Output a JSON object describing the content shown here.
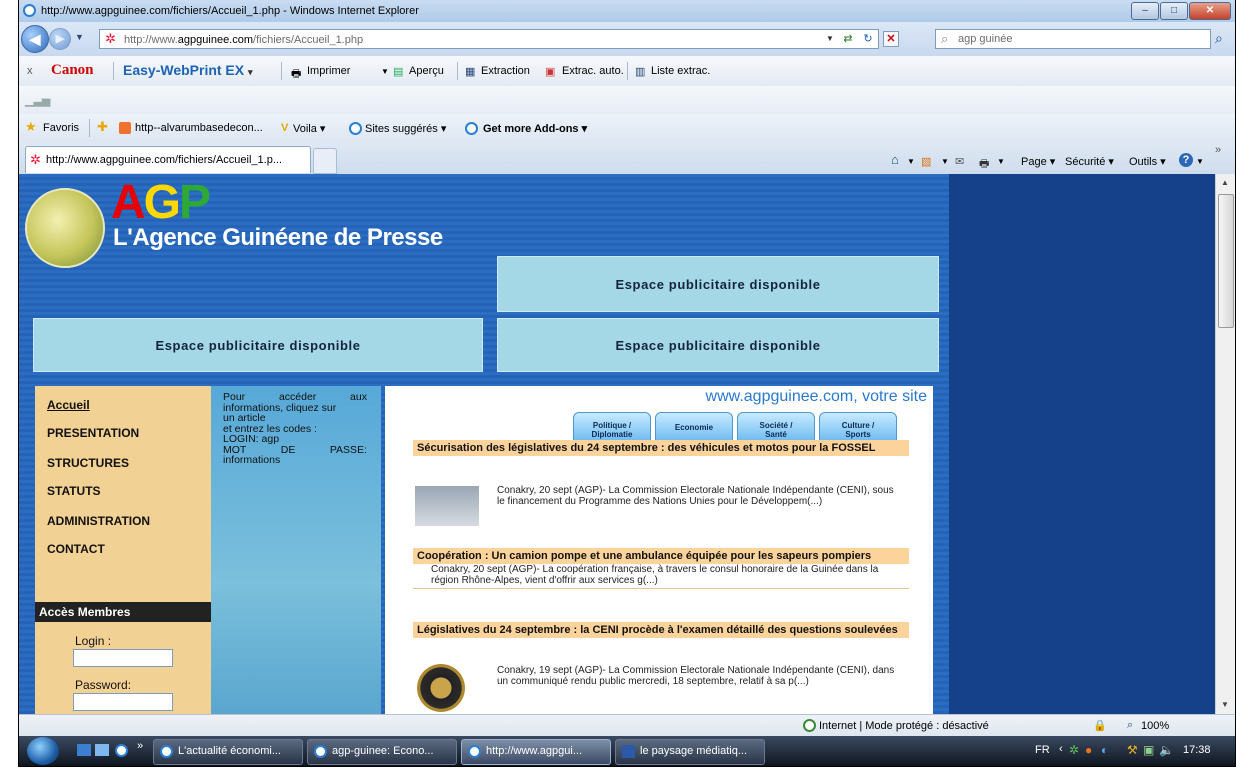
{
  "window": {
    "title": "http://www.agpguinee.com/fichiers/Accueil_1.php - Windows Internet Explorer"
  },
  "nav": {
    "address_prefix": "http://www.",
    "address_domain": "agpguinee.com",
    "address_path": "/fichiers/Accueil_1.php",
    "search_value": "agp guinée"
  },
  "toolbar": {
    "close_x": "x",
    "canon": "Canon",
    "ewp": "Easy-WebPrint EX",
    "ewp_arrow": "▾",
    "print": "Imprimer",
    "preview": "Aperçu",
    "extraction": "Extraction",
    "extrac_auto": "Extrac. auto.",
    "liste": "Liste extrac."
  },
  "favbar": {
    "favoris": "Favoris",
    "link1": "http--alvarumbasedecon...",
    "link2": "Voila ▾",
    "link3": "Sites suggérés ▾",
    "link4": "Get more Add-ons ▾"
  },
  "tab": {
    "title": "http://www.agpguinee.com/fichiers/Accueil_1.p..."
  },
  "commands": {
    "page": "Page ▾",
    "securite": "Sécurité ▾",
    "outils": "Outils ▾",
    "more": "»"
  },
  "site": {
    "logo_a": "A",
    "logo_g": "G",
    "logo_p": "P",
    "tagline": "L'Agence Guinéene de Presse",
    "ad_label": "Espace publicitaire disponible",
    "slogan": "www.agpguinee.com, votre site",
    "nav": [
      "Accueil",
      "PRESENTATION",
      "STRUCTURES",
      "STATUTS",
      "ADMINISTRATION",
      "CONTACT"
    ],
    "members_title": "Accès Membres",
    "login_label": "Login :",
    "password_label": "Password:",
    "info": {
      "l1a": "Pour",
      "l1b": "accéder",
      "l1c": "aux",
      "l2": "informations, cliquez sur",
      "l3": "un article",
      "l4": "et entrez les codes :",
      "l5": "LOGIN: agp",
      "l6a": "MOT",
      "l6b": "DE",
      "l6c": "PASSE:",
      "l7": "informations"
    },
    "tabs": [
      {
        "l1": "Politique /",
        "l2": "Diplomatie"
      },
      {
        "l1": "Economie",
        "l2": ""
      },
      {
        "l1": "Société /",
        "l2": "Santé"
      },
      {
        "l1": "Culture /",
        "l2": "Sports"
      }
    ],
    "articles": [
      {
        "title": "Sécurisation des législatives du 24 septembre : des véhicules et motos pour la FOSSEL",
        "body": "Conakry, 20 sept (AGP)- La Commission Electorale Nationale Indépendante (CENI), sous le financement du Programme des Nations Unies pour le Développem(...)"
      },
      {
        "title": "Coopération : Un camion pompe et une ambulance équipée pour les sapeurs pompiers",
        "body": "Conakry, 20 sept (AGP)- La coopération française, à travers le consul honoraire de la Guinée dans la région Rhône-Alpes, vient d'offrir aux services g(...)"
      },
      {
        "title": "Législatives du 24 septembre : la CENI procède à l'examen détaillé des questions soulevées",
        "body": "Conakry, 19 sept (AGP)- La Commission Electorale Nationale Indépendante (CENI), dans un communiqué rendu public mercredi, 18 septembre, relatif à sa p(...)"
      }
    ]
  },
  "status": {
    "zone": "Internet | Mode protégé : désactivé",
    "zoom": "100%"
  },
  "taskbar": {
    "items": [
      "L'actualité économi...",
      "agp-guinee: Econo...",
      "http://www.agpgui...",
      "le paysage médiatiq..."
    ],
    "lang": "FR",
    "time": "17:38",
    "chevron": "»"
  }
}
